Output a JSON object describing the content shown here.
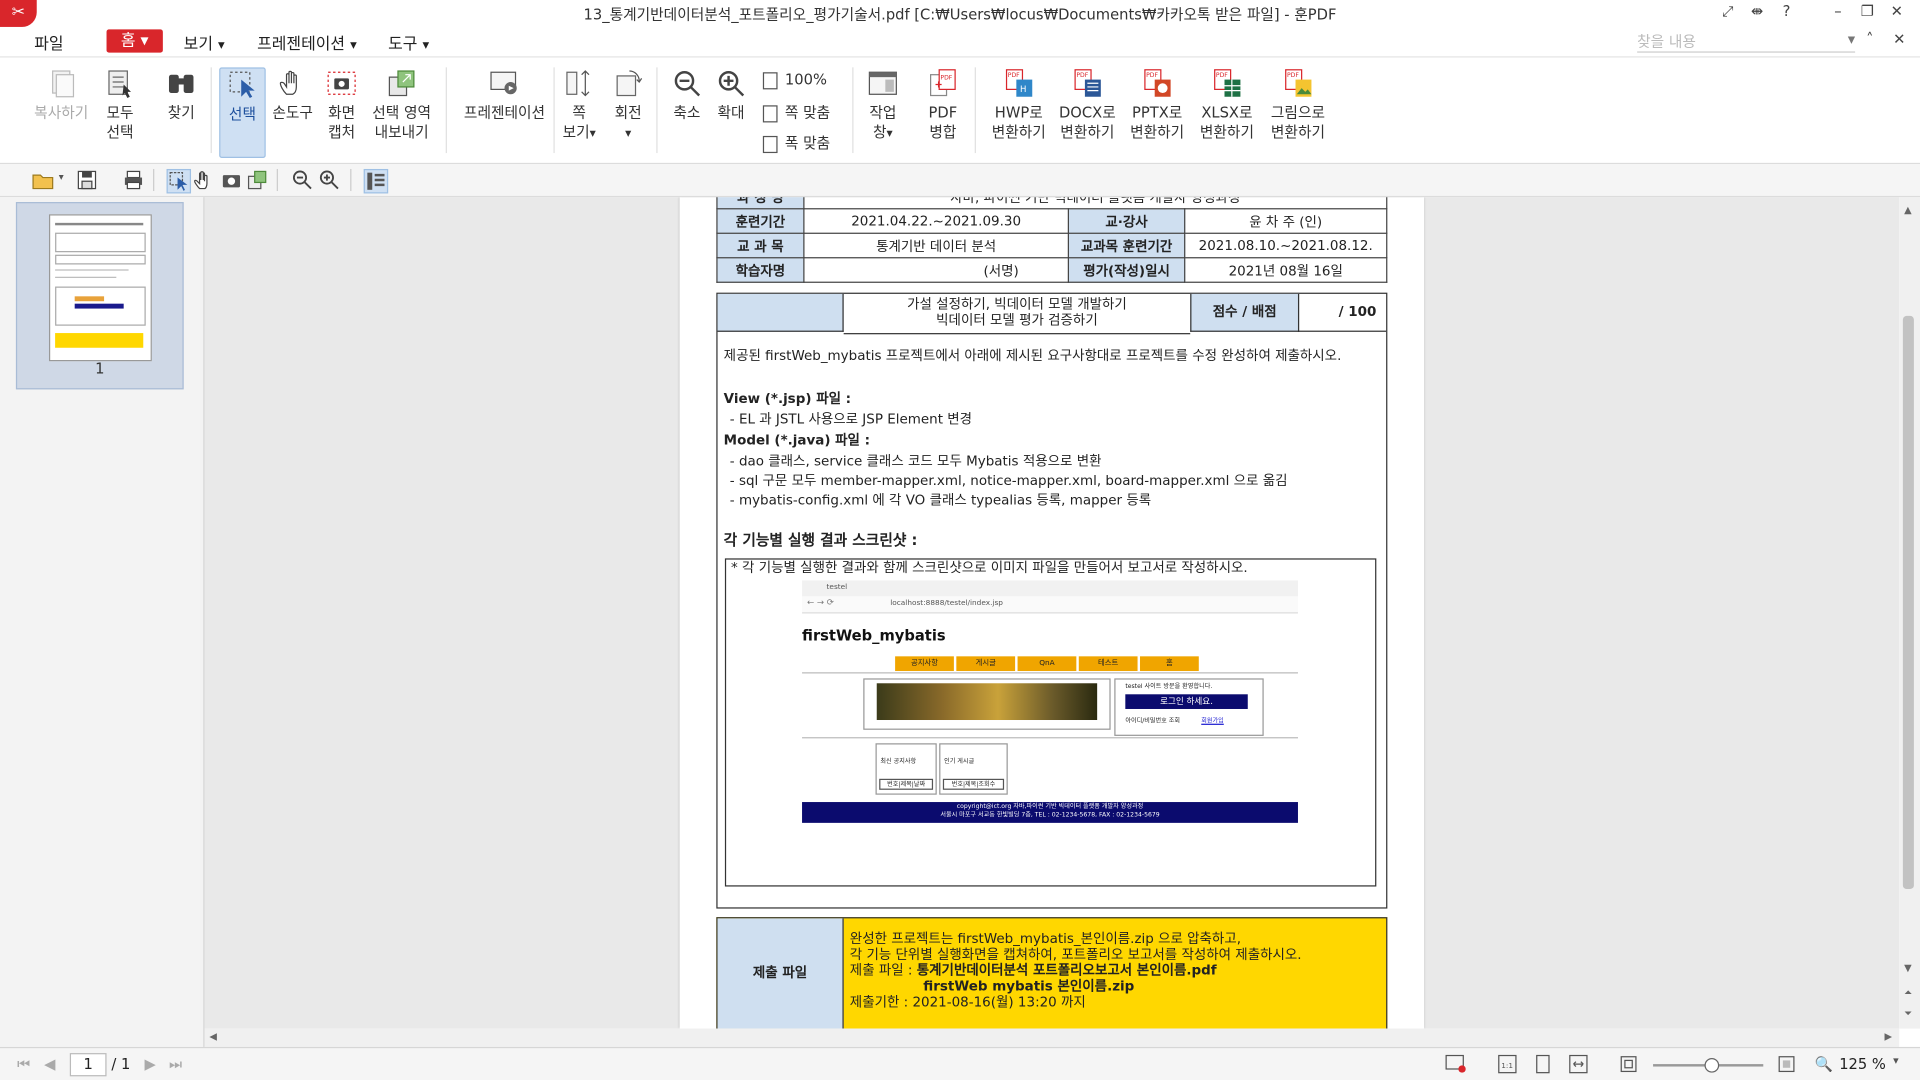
{
  "window": {
    "title": "13_통계기반데이터분석_포트폴리오_평가기술서.pdf [C:₩Users₩locus₩Documents₩카카오톡 받은 파일] - 훈PDF"
  },
  "menu": {
    "file": "파일",
    "home": "홈",
    "view": "보기",
    "presentation": "프레젠테이션",
    "tools": "도구",
    "search_placeholder": "찾을 내용"
  },
  "ribbon": {
    "copy": "복사하기",
    "select_all": [
      "모두",
      "선택"
    ],
    "find": "찾기",
    "select": "선택",
    "hand": "손도구",
    "screen_capture": [
      "화면",
      "캡처"
    ],
    "export_selection": [
      "선택 영역",
      "내보내기"
    ],
    "presentation": "프레젠테이션",
    "page_view": [
      "쪽",
      "보기"
    ],
    "rotate": "회전",
    "zoom_out": "축소",
    "zoom_in": "확대",
    "zoom_100": "100%",
    "fit_page": "쪽 맞춤",
    "fit_width": "폭 맞춤",
    "work_window": [
      "작업",
      "창"
    ],
    "pdf_merge": [
      "PDF",
      "병합"
    ],
    "to_hwp": [
      "HWP로",
      "변환하기"
    ],
    "to_docx": [
      "DOCX로",
      "변환하기"
    ],
    "to_pptx": [
      "PPTX로",
      "변환하기"
    ],
    "to_xlsx": [
      "XLSX로",
      "변환하기"
    ],
    "to_image": [
      "그림으로",
      "변환하기"
    ]
  },
  "thumbnail": {
    "page_number": "1"
  },
  "document": {
    "row0": {
      "label": "과 정 명",
      "value": "자바, 파이썬 기반 빅데이터 플랫폼 개발자 양성과정"
    },
    "row1": {
      "label1": "훈련기간",
      "value1": "2021.04.22.~2021.09.30",
      "label2": "교·강사",
      "value2": "윤 차 주 (인)"
    },
    "row2": {
      "label1": "교 과 목",
      "value1": "통계기반 데이터 분석",
      "label2": "교과목 훈련기간",
      "value2": "2021.08.10.~2021.08.12."
    },
    "row3": {
      "label1": "학습자명",
      "value1": "(서명)",
      "label2": "평가(작성)일시",
      "value2": "2021년 08월 16일"
    },
    "task_line1": "가설 설정하기, 빅데이터 모델 개발하기",
    "task_line2": "빅데이터 모델 평가 검증하기",
    "score_label": "점수 / 배점",
    "score_value": "/ 100",
    "intro": "제공된 firstWeb_mybatis 프로젝트에서 아래에 제시된 요구사항대로 프로젝트를 수정 완성하여 제출하시오.",
    "view_heading": "View (*.jsp) 파일 :",
    "view_item1": "- EL 과 JSTL 사용으로 JSP Element 변경",
    "model_heading": "Model (*.java) 파일 :",
    "model_item1": "- dao 클래스, service 클래스 코드 모두 Mybatis 적용으로 변환",
    "model_item2": "- sql 구문 모두 member-mapper.xml, notice-mapper.xml, board-mapper.xml 으로 옮김",
    "model_item3": "- mybatis-config.xml 에 각 VO 클래스 typealias 등록, mapper 등록",
    "screenshot_heading": "각 기능별 실행 결과 스크린샷 :",
    "screenshot_note": "* 각 기능별 실행한 결과와 함께 스크린샷으로 이미지 파일을 만들어서 보고서로 작성하시오.",
    "submit_label": "제출 파일",
    "submit_line1": "완성한 프로젝트는 firstWeb_mybatis_본인이름.zip 으로 압축하고,",
    "submit_line2": "각 기능 단위별 실행화면을 캡쳐하여, 포트폴리오 보고서를 작성하여 제출하시오.",
    "submit_line3_prefix": "제출 파일 : ",
    "submit_line3_bold": "통계기반데이터분석 포트폴리오보고서 본인이름.pdf",
    "submit_line4_bold": "firstWeb mybatis 본인이름.zip",
    "submit_line5": "제출기한 : 2021-08-16(월) 13:20 까지"
  },
  "embedded_screenshot": {
    "tab_title": "testel",
    "url": "localhost:8888/testel/index.jsp",
    "site_title": "firstWeb_mybatis",
    "nav": [
      "공지사항",
      "게시글",
      "QnA",
      "테스트",
      "홈"
    ],
    "welcome": "testel 사이트 방문을 환영합니다.",
    "login_button": "로그인 하세요.",
    "find_id": "아이디/비밀번호 조회",
    "signup": "회원가입",
    "recent_notice": "최신 공지사항",
    "popular_posts": "인기 게시글",
    "notice_cols": "번호|제목|날짜",
    "post_cols": "번호|제목|조회수",
    "footer1": "copyright@ict.org  자바,파이썬 기반 빅데이터 플랫폼 개발자 양성과정",
    "footer2": "서울시 마포구 서교동 한빛빌딩 7층, TEL : 02-1234-5678, FAX : 02-1234-5679"
  },
  "statusbar": {
    "page_current": "1",
    "page_total": "/ 1",
    "zoom": "125 %"
  }
}
